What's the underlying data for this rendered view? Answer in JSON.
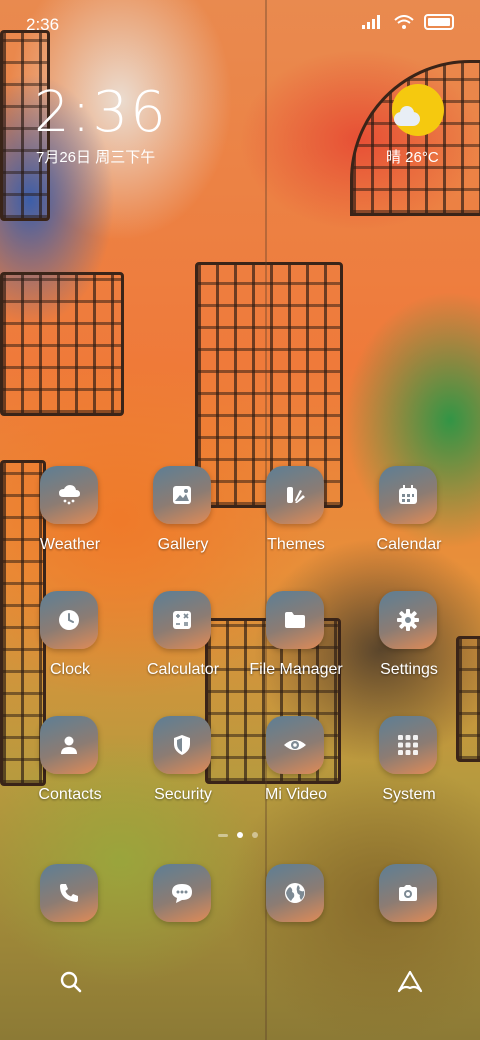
{
  "status_bar": {
    "time": "2:36",
    "signal_icon": "signal-icon",
    "wifi_icon": "wifi-icon",
    "battery_icon": "battery-icon"
  },
  "clock_widget": {
    "time": "2:36",
    "date": "7月26日 周三下午"
  },
  "weather_widget": {
    "text": "晴 26°C",
    "icon": "sunny-partly-cloudy-icon"
  },
  "apps": [
    {
      "label": "Weather",
      "icon": "cloud-rain-icon"
    },
    {
      "label": "Gallery",
      "icon": "image-icon"
    },
    {
      "label": "Themes",
      "icon": "brush-icon"
    },
    {
      "label": "Calendar",
      "icon": "calendar-icon"
    },
    {
      "label": "Clock",
      "icon": "clock-icon"
    },
    {
      "label": "Calculator",
      "icon": "calculator-icon"
    },
    {
      "label": "File Manager",
      "icon": "folder-icon"
    },
    {
      "label": "Settings",
      "icon": "gear-icon"
    },
    {
      "label": "Contacts",
      "icon": "person-icon"
    },
    {
      "label": "Security",
      "icon": "shield-icon"
    },
    {
      "label": "Mi Video",
      "icon": "eye-icon"
    },
    {
      "label": "System",
      "icon": "folder-grid-icon"
    }
  ],
  "page_indicator": {
    "pages": 3,
    "current": 2
  },
  "dock": [
    {
      "icon": "phone-icon"
    },
    {
      "icon": "message-icon"
    },
    {
      "icon": "globe-icon"
    },
    {
      "icon": "camera-icon"
    }
  ],
  "bottom_bar": {
    "search_icon": "search-icon",
    "assistant_icon": "assistant-icon"
  },
  "colors": {
    "icon_top": "#5d7f95",
    "icon_bottom": "#e08b57",
    "sun": "#f5c90f"
  }
}
